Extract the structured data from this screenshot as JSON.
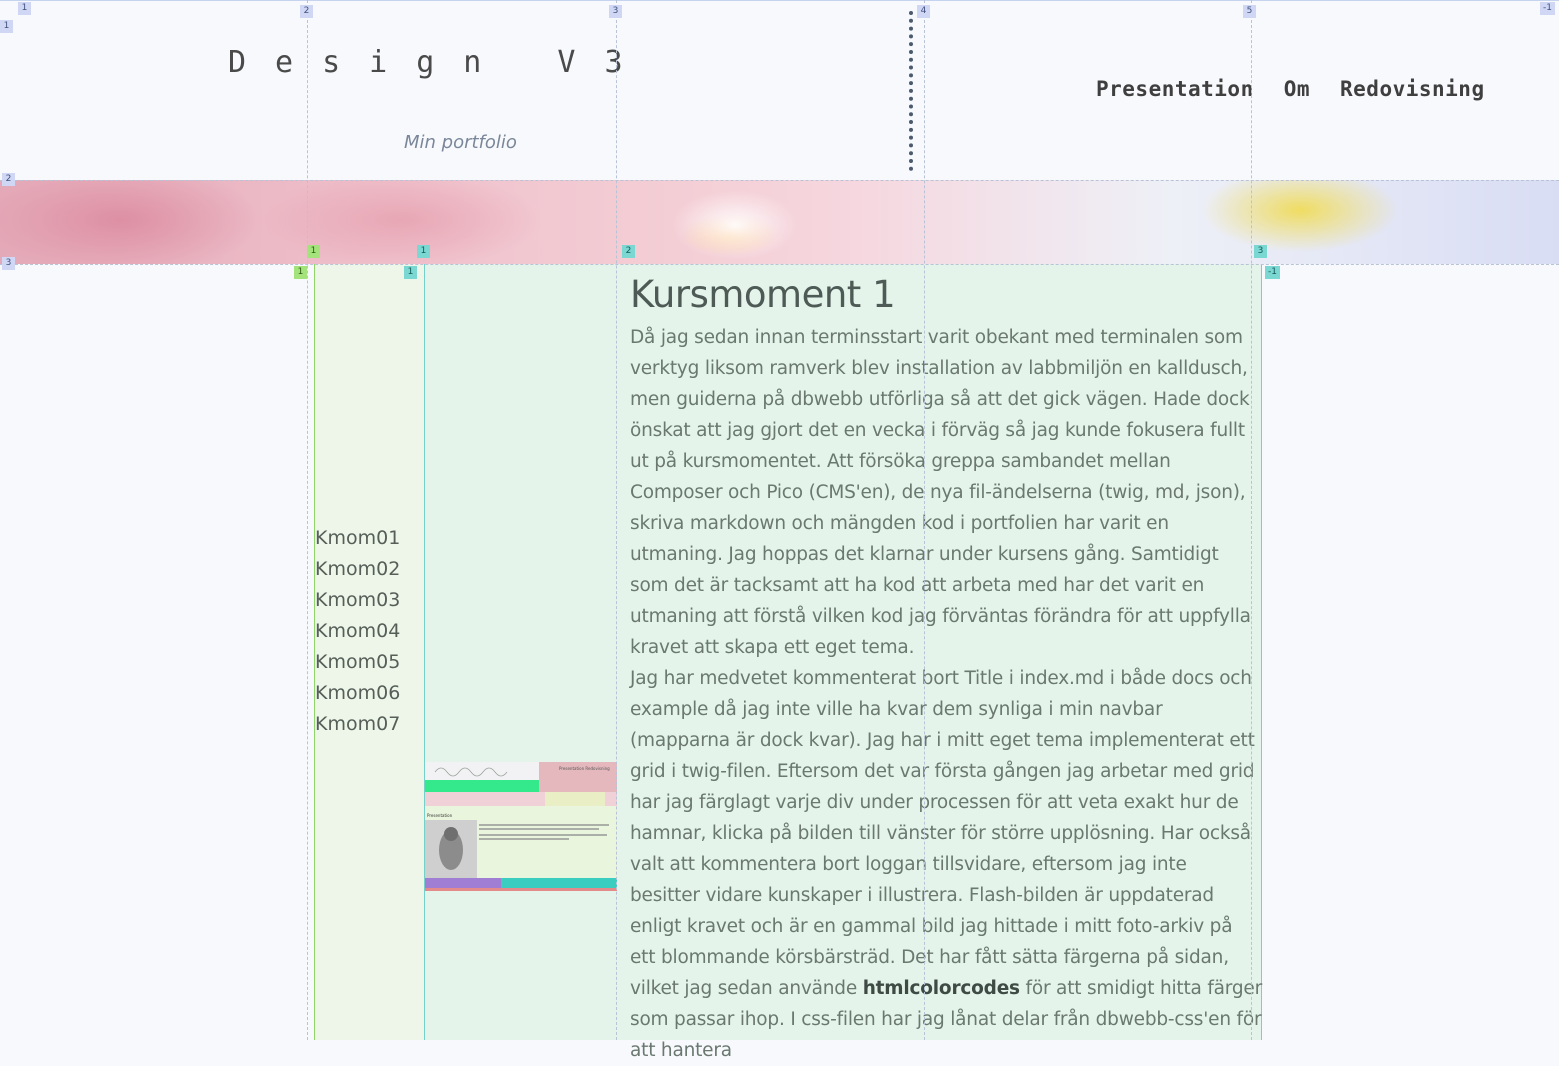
{
  "header": {
    "title": "Design V3",
    "slogan": "Min portfolio",
    "nav": [
      "Presentation",
      "Om",
      "Redovisning"
    ]
  },
  "sidebar": {
    "items": [
      "Kmom01",
      "Kmom02",
      "Kmom03",
      "Kmom04",
      "Kmom05",
      "Kmom06",
      "Kmom07"
    ]
  },
  "thumbnail": {
    "heading": "Presentation",
    "nav": "Presentation   Redovisning"
  },
  "article": {
    "title": "Kursmoment 1",
    "p1": "Då jag sedan innan terminsstart varit obekant med terminalen som verktyg liksom ramverk blev installation av labbmiljön en kalldusch, men guiderna på dbwebb utförliga så att det gick vägen. Hade dock önskat att jag gjort det en vecka i förväg så jag kunde fokusera fullt ut på kursmomentet. Att försöka greppa sambandet mellan Composer och Pico (CMS'en), de nya fil-ändelserna (twig, md, json), skriva markdown och mängden kod i portfolien har varit en utmaning. Jag hoppas det klarnar under kursens gång. Samtidigt som det är tacksamt att ha kod att arbeta med har det varit en utmaning att förstå vilken kod jag förväntas förändra för att uppfylla kravet att skapa ett eget tema.",
    "p2_before": "Jag har medvetet kommenterat bort Title i index.md i både docs och example då jag inte ville ha kvar dem synliga i min navbar (mapparna är dock kvar). Jag har i mitt eget tema implementerat ett grid i twig-filen. Eftersom det var första gången jag arbetar med grid har jag färglagt varje div under processen för att veta exakt hur de hamnar, klicka på bilden till vänster för större upplösning. Har också valt att kommentera bort loggan tillsvidare, eftersom jag inte besitter vidare kunskaper i illustrera. Flash-bilden är uppdaterad enligt kravet och är en gammal bild jag hittade i mitt foto-arkiv på ett blommande körsbärsträd. Det har fått sätta färgerna på sidan, vilket jag sedan använde ",
    "p2_link": "htmlcolorcodes",
    "p2_after": " för att smidigt hitta färger som passar ihop. I css-filen har jag lånat delar från dbwebb-css'en för att hantera"
  },
  "grid_markers": {
    "col_top": [
      "1",
      "2",
      "3",
      "4",
      "5",
      "-1"
    ],
    "row_left": [
      "1",
      "2",
      "3"
    ],
    "inner_green": [
      "1",
      "1"
    ],
    "inner_teal": [
      "1",
      "1",
      "2",
      "3",
      "-1"
    ]
  },
  "colors": {
    "sidebar_bg": "#eef6ea",
    "article_bg": "#e4f4ea",
    "marker_blue": "#cfd7f4",
    "marker_green": "#a4e37b",
    "marker_teal": "#7ad7d2"
  }
}
